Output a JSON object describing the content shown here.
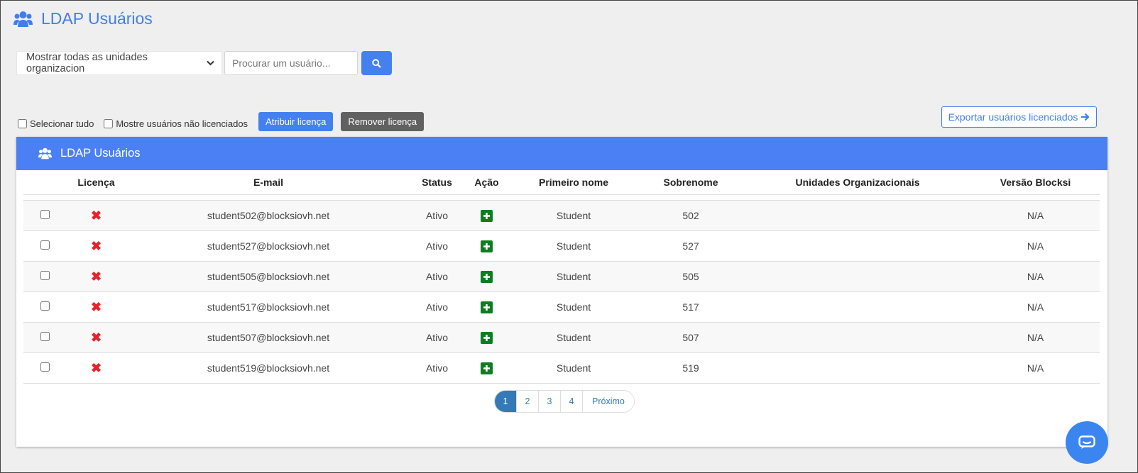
{
  "page": {
    "title": "LDAP Usuários"
  },
  "filters": {
    "ou_select_value": "Mostrar todas as unidades organizacion",
    "search_placeholder": "Procurar um usuário..."
  },
  "toolbar": {
    "select_all_label": "Selecionar tudo",
    "show_unlicensed_label": "Mostre usuários não licenciados",
    "assign_label": "Atribuir licença",
    "remove_label": "Remover licença",
    "export_label": "Exportar usuários licenciados"
  },
  "panel": {
    "title": "LDAP Usuários"
  },
  "table": {
    "columns": [
      "Licença",
      "E-mail",
      "Status",
      "Ação",
      "Primeiro nome",
      "Sobrenome",
      "Unidades Organizacionais",
      "Versão Blocksi"
    ],
    "rows": [
      {
        "email": "student502@blocksiovh.net",
        "status": "Ativo",
        "first_name": "Student",
        "last_name": "502",
        "ou": "",
        "version": "N/A"
      },
      {
        "email": "student527@blocksiovh.net",
        "status": "Ativo",
        "first_name": "Student",
        "last_name": "527",
        "ou": "",
        "version": "N/A"
      },
      {
        "email": "student505@blocksiovh.net",
        "status": "Ativo",
        "first_name": "Student",
        "last_name": "505",
        "ou": "",
        "version": "N/A"
      },
      {
        "email": "student517@blocksiovh.net",
        "status": "Ativo",
        "first_name": "Student",
        "last_name": "517",
        "ou": "",
        "version": "N/A"
      },
      {
        "email": "student507@blocksiovh.net",
        "status": "Ativo",
        "first_name": "Student",
        "last_name": "507",
        "ou": "",
        "version": "N/A"
      },
      {
        "email": "student519@blocksiovh.net",
        "status": "Ativo",
        "first_name": "Student",
        "last_name": "519",
        "ou": "",
        "version": "N/A"
      }
    ]
  },
  "pagination": {
    "pages": [
      "1",
      "2",
      "3",
      "4"
    ],
    "next_label": "Próximo",
    "current": "1"
  },
  "icons": {
    "license": "x-icon",
    "action": "plus-icon",
    "search": "search-icon",
    "users": "users-icon",
    "chat": "chat-icon",
    "export": "arrow-right-icon"
  },
  "colors": {
    "accent": "#4580f0",
    "header": "#4a80f4",
    "remove_button": "#616161",
    "license_x": "#e8212b",
    "action_plus": "#0e7d20",
    "pagination_active": "#337ab7"
  }
}
